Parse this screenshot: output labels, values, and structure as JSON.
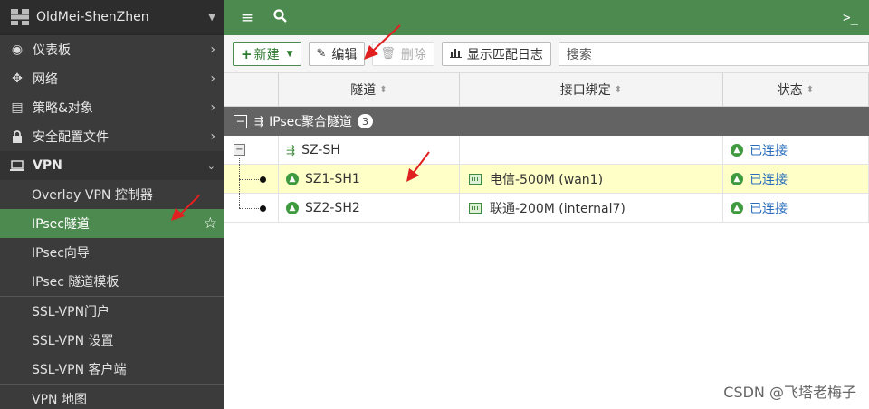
{
  "sidebar": {
    "hostname": "OldMei-ShenZhen",
    "items": [
      {
        "label": "仪表板",
        "icon": "dashboard-icon"
      },
      {
        "label": "网络",
        "icon": "network-icon"
      },
      {
        "label": "策略&对象",
        "icon": "policy-icon"
      },
      {
        "label": "安全配置文件",
        "icon": "lock-icon"
      },
      {
        "label": "VPN",
        "icon": "laptop-icon"
      }
    ],
    "vpn_sub": [
      {
        "label": "Overlay VPN 控制器"
      },
      {
        "label": "IPsec隧道"
      },
      {
        "label": "IPsec向导"
      },
      {
        "label": "IPsec 隧道模板"
      },
      {
        "label": "SSL-VPN门户"
      },
      {
        "label": "SSL-VPN 设置"
      },
      {
        "label": "SSL-VPN 客户端"
      },
      {
        "label": "VPN 地图"
      }
    ]
  },
  "toolbar": {
    "new_label": "新建",
    "edit_label": "编辑",
    "delete_label": "删除",
    "log_label": "显示匹配日志",
    "search_placeholder": "搜索"
  },
  "table": {
    "headers": [
      "隧道",
      "接口绑定",
      "状态"
    ],
    "group": {
      "label": "IPsec聚合隧道",
      "count": "3"
    },
    "rows": [
      {
        "tunnel": "SZ-SH",
        "interface": "",
        "status": "已连接"
      },
      {
        "tunnel": "SZ1-SH1",
        "interface": "电信-500M (wan1)",
        "status": "已连接"
      },
      {
        "tunnel": "SZ2-SH2",
        "interface": "联通-200M (internal7)",
        "status": "已连接"
      }
    ]
  },
  "watermark": "CSDN @飞塔老梅子",
  "colors": {
    "accent": "#4d8a4f",
    "sidebar": "#3b3b3b",
    "highlight_row": "#ffffc8",
    "arrow": "#e02020"
  }
}
